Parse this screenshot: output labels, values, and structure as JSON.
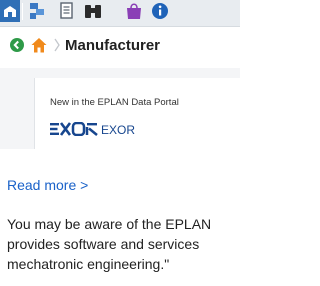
{
  "toolbar": {
    "icons": [
      "home-icon",
      "properties-icon",
      "document-icon",
      "binoculars-icon",
      "shopping-bag-icon",
      "info-icon"
    ]
  },
  "breadcrumb": {
    "title": "Manufacturer"
  },
  "card": {
    "heading": "New in the EPLAN Data Portal",
    "brand_name": "EXOR",
    "logo_text": "EXOR",
    "logo_color": "#17468e"
  },
  "article": {
    "read_more": "Read more >",
    "line1": "You may be aware of the EPLAN",
    "line2": "provides software and services",
    "line3": "mechatronic engineering.\""
  },
  "colors": {
    "link": "#1a62c9",
    "back_green": "#2e9a48",
    "home_orange": "#f08a1c",
    "toolbar_blue": "#2f6fb6"
  }
}
